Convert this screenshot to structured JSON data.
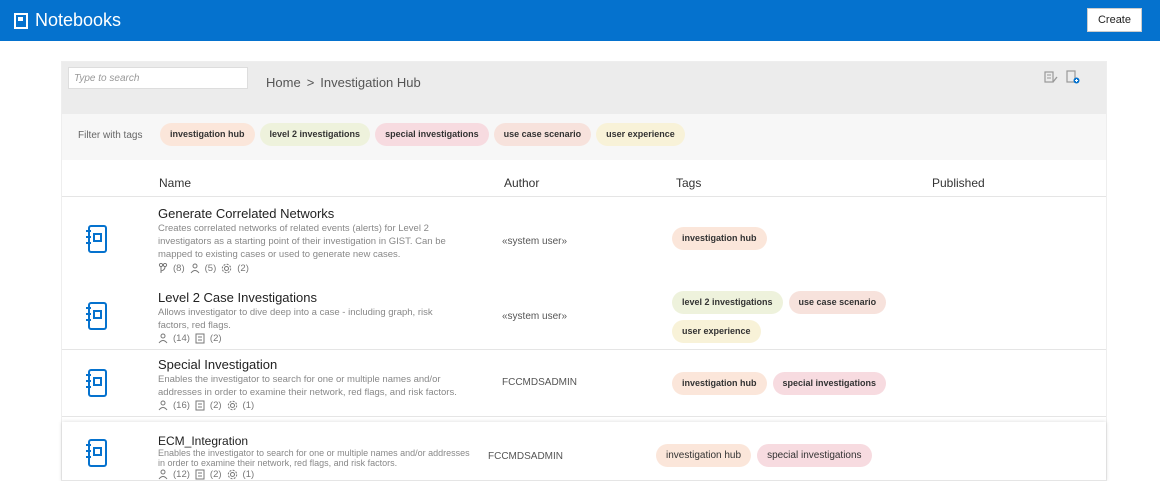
{
  "app": {
    "title": "Notebooks",
    "create_label": "Create"
  },
  "search": {
    "placeholder": "Type to search"
  },
  "breadcrumb": {
    "home": "Home",
    "separator": ">",
    "current": "Investigation Hub"
  },
  "filter": {
    "label": "Filter with tags",
    "tags": [
      {
        "label": "investigation hub",
        "color": "#fbe6da"
      },
      {
        "label": "level 2 investigations",
        "color": "#eef2dc"
      },
      {
        "label": "special investigations",
        "color": "#f7dbe0"
      },
      {
        "label": "use case scenario",
        "color": "#f7e2dc"
      },
      {
        "label": "user experience",
        "color": "#f8f2d8"
      }
    ]
  },
  "columns": {
    "name": "Name",
    "author": "Author",
    "tags": "Tags",
    "published": "Published"
  },
  "rows": [
    {
      "title": "Generate Correlated Networks",
      "desc1": "Creates correlated networks of related events (alerts) for Level 2",
      "desc2": "investigators as a starting point of their investigation in GIST. Can be",
      "desc3": "mapped to existing cases or used to generate new cases.",
      "stat_a": "(8)",
      "stat_b": "(5)",
      "stat_c": "(2)",
      "author": "«system user»",
      "tag1": "investigation hub"
    },
    {
      "title": "Level 2 Case Investigations",
      "desc1": "Allows investigator to dive deep into a case - including graph, risk",
      "desc2": "factors, red flags.",
      "stat_a": "(14)",
      "stat_b": "(2)",
      "author": "«system user»",
      "tag1": "level 2 investigations",
      "tag2": "use case scenario",
      "tag3": "user experience"
    },
    {
      "title": "Special Investigation",
      "desc1": "Enables the investigator to search for one or multiple names and/or",
      "desc2": "addresses in order to examine their network, red flags, and risk factors.",
      "stat_a": "(16)",
      "stat_b": "(2)",
      "stat_c": "(1)",
      "author": "FCCMDSADMIN",
      "tag1": "investigation hub",
      "tag2": "special investigations"
    },
    {
      "title": "ECM_Integration",
      "desc1": "Enables the investigator to search for one or multiple names and/or addresses",
      "desc2": "in order to examine their network, red flags, and risk factors.",
      "stat_a": "(12)",
      "stat_b": "(2)",
      "stat_c": "(1)",
      "author": "FCCMDSADMIN",
      "tag1": "investigation hub",
      "tag2": "special investigations"
    }
  ],
  "icons": {
    "notebook": "notebook-icon",
    "stat_a": "branch-icon",
    "stat_b": "user-icon",
    "stat_c": "gear-icon"
  }
}
